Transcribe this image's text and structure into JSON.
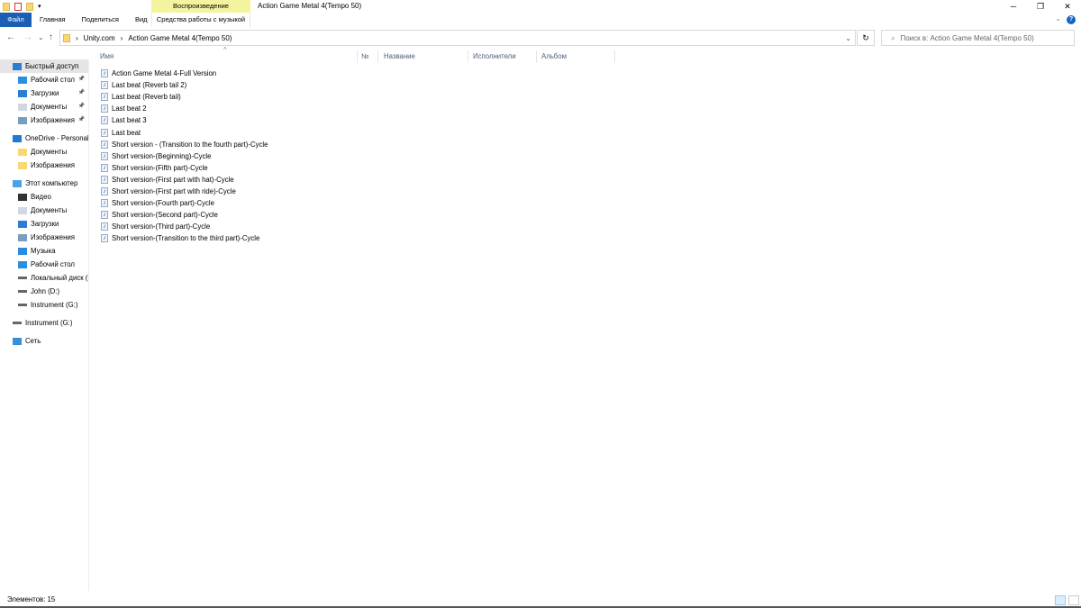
{
  "window": {
    "title": "Action Game Metal 4(Tempo 50)",
    "minimize": "─",
    "restore": "❐",
    "close": "✕"
  },
  "ribbon": {
    "context_group": "Воспроизведение",
    "tabs": [
      "Файл",
      "Главная",
      "Поделиться",
      "Вид"
    ],
    "context_tab": "Средства работы с музыкой",
    "help": "?",
    "expand": "⌄"
  },
  "nav": {
    "back": "←",
    "forward": "→",
    "recent": "⌄",
    "up": "↑"
  },
  "address": {
    "sep": "›",
    "crumbs": [
      "Unity.com",
      "Action Game Metal 4(Tempo 50)"
    ],
    "dropdown": "⌄",
    "refresh": "↻"
  },
  "search": {
    "placeholder": "Поиск в: Action Game Metal 4(Tempo 50)",
    "icon": "⌕"
  },
  "sidebar": {
    "items": [
      {
        "label": "Быстрый доступ",
        "icon": "star-icon",
        "level": 0
      },
      {
        "label": "Рабочий стол",
        "icon": "desktop-icon",
        "level": 1,
        "pinned": true
      },
      {
        "label": "Загрузки",
        "icon": "download-icon",
        "level": 1,
        "pinned": true
      },
      {
        "label": "Документы",
        "icon": "document-icon",
        "level": 1,
        "pinned": true
      },
      {
        "label": "Изображения",
        "icon": "pictures-icon",
        "level": 1,
        "pinned": true
      },
      {
        "label": "OneDrive - Personal",
        "icon": "cloud-icon",
        "level": 0
      },
      {
        "label": "Документы",
        "icon": "folder-icon",
        "level": 1
      },
      {
        "label": "Изображения",
        "icon": "folder-icon",
        "level": 1
      },
      {
        "label": "Этот компьютер",
        "icon": "computer-icon",
        "level": 0
      },
      {
        "label": "Видео",
        "icon": "video-icon",
        "level": 1
      },
      {
        "label": "Документы",
        "icon": "document-icon",
        "level": 1
      },
      {
        "label": "Загрузки",
        "icon": "download-icon",
        "level": 1
      },
      {
        "label": "Изображения",
        "icon": "pictures-icon",
        "level": 1
      },
      {
        "label": "Музыка",
        "icon": "music-icon",
        "level": 1
      },
      {
        "label": "Рабочий стол",
        "icon": "desktop-icon",
        "level": 1
      },
      {
        "label": "Локальный диск (C",
        "icon": "drive-icon",
        "level": 1
      },
      {
        "label": "John (D:)",
        "icon": "drive-icon",
        "level": 1
      },
      {
        "label": "Instrument (G:)",
        "icon": "drive-icon",
        "level": 1
      },
      {
        "label": "Instrument (G:)",
        "icon": "drive-icon",
        "level": 0
      },
      {
        "label": "Сеть",
        "icon": "network-icon",
        "level": 0
      }
    ],
    "pin": "📌"
  },
  "columns": [
    "Имя",
    "№",
    "Название",
    "Исполнители",
    "Альбом"
  ],
  "sort_indicator": "^",
  "files": [
    "Action Game Metal 4-Full Version",
    "Last beat (Reverb tail 2)",
    "Last beat (Reverb tail)",
    "Last beat 2",
    "Last beat 3",
    "Last beat",
    "Short version - (Transition to the fourth part)-Cycle",
    "Short version-(Beginning)-Cycle",
    "Short version-(Fifth part)-Cycle",
    "Short version-(First part with hat)-Cycle",
    "Short version-(First part with ride)-Cycle",
    "Short version-(Fourth part)-Cycle",
    "Short version-(Second part)-Cycle",
    "Short version-(Third part)-Cycle",
    "Short version-(Transition to the third part)-Cycle"
  ],
  "file_icon": "♪",
  "status": {
    "items": "Элементов: 15"
  }
}
